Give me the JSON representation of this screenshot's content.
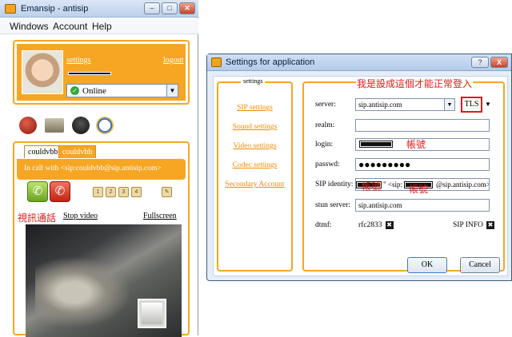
{
  "emansip": {
    "title": "Emansip - antisip",
    "menu": [
      "Windows",
      "Account",
      "Help"
    ],
    "profile": {
      "settings_link": "settings",
      "logout_link": "logout",
      "status": "Online"
    },
    "call": {
      "tabs": [
        "couldvbb",
        "couldvbb"
      ],
      "in_call_text": "In call with <sip:couldvbb@sip.antisip.com>",
      "video_label": "視訊通話",
      "stop_video": "Stop video",
      "fullscreen": "Fullscreen",
      "keypad_icons": [
        "1",
        "2",
        "3",
        "4"
      ]
    }
  },
  "settings": {
    "title": "Settings for application",
    "help_btn": "?",
    "close_btn": "X",
    "nav_legend": "settings",
    "nav": [
      "SIP settings",
      "Sound settings",
      "Video settings",
      "Codec settings",
      "Secondary Account"
    ],
    "annotation_top": "我是設成這個才能正常登入",
    "fields": {
      "server_label": "server:",
      "server_value": "sip.antisip.com",
      "transport": "TLS",
      "realm_label": "realm:",
      "realm_value": "",
      "login_label": "login:",
      "login_annot": "帳號",
      "passwd_label": "passwd:",
      "passwd_dots": "●●●●●●●●●",
      "sip_identity_label": "SIP identity:",
      "sip_identity_value": "\" <sip:",
      "sip_identity_suffix": "@sip.antisip.com>",
      "sip_identity_annot_left": "帳號",
      "sip_identity_annot_right": "帳號",
      "stun_label": "stun server:",
      "stun_value": "sip.antisip.com",
      "dtmf_label": "dtmf:",
      "dtmf_rfc": "rfc2833",
      "dtmf_sipinfo": "SIP INFO"
    },
    "ok": "OK",
    "cancel": "Cancel"
  }
}
